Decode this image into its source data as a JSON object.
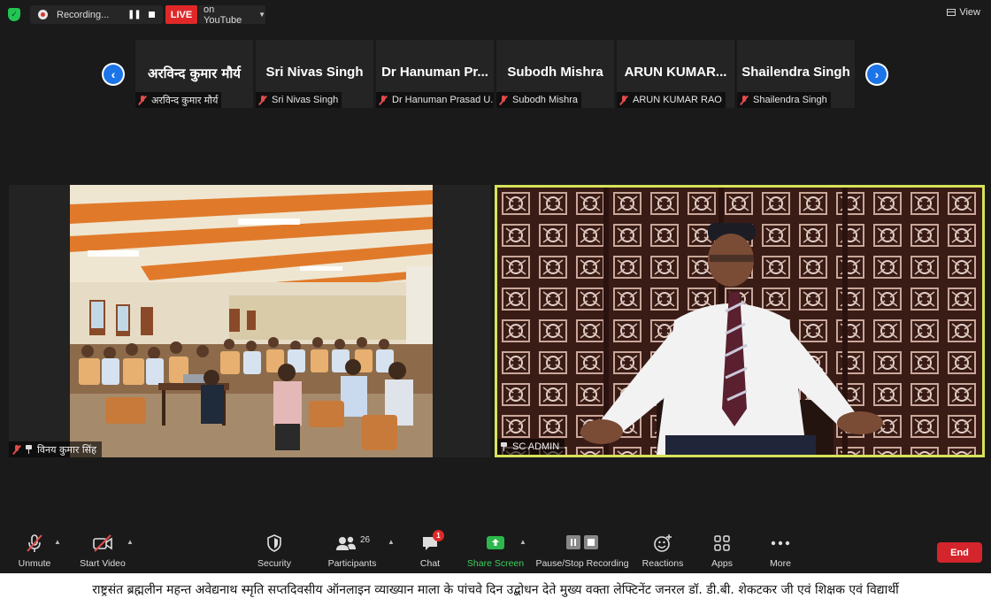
{
  "top_bar": {
    "recording_label": "Recording...",
    "live_label": "LIVE",
    "youtube_label": "on YouTube",
    "view_label": "View"
  },
  "thumbnails": [
    {
      "name": "अरविन्द कुमार मौर्य",
      "tag": "अरविन्द कुमार मौर्य"
    },
    {
      "name": "Sri Nivas Singh",
      "tag": "Sri Nivas Singh"
    },
    {
      "name": "Dr Hanuman Pr...",
      "tag": "Dr Hanuman Prasad U..."
    },
    {
      "name": "Subodh Mishra",
      "tag": "Subodh Mishra"
    },
    {
      "name": "ARUN  KUMAR...",
      "tag": "ARUN KUMAR RAO"
    },
    {
      "name": "Shailendra Singh",
      "tag": "Shailendra Singh"
    }
  ],
  "tiles": {
    "left_name": "विनय कुमार सिंह",
    "right_name": "SC ADMIN",
    "active_speaker_color": "#d7e35a"
  },
  "toolbar": {
    "unmute": "Unmute",
    "start_video": "Start Video",
    "security": "Security",
    "participants": "Participants",
    "participants_count": "26",
    "chat": "Chat",
    "chat_badge": "1",
    "share_screen": "Share Screen",
    "pause_recording": "Pause/Stop Recording",
    "reactions": "Reactions",
    "apps": "Apps",
    "more": "More",
    "end": "End"
  },
  "caption": "राष्ट्रसंत ब्रह्मलीन महन्त अवेद्यनाथ स्मृति सप्तदिवसीय ऑनलाइन व्याख्यान माला के पांचवे दिन उद्बोधन देते मुख्य वक्ता लेफ्टिनेंट जनरल डॉ. डी.बी. शेकटकर जी एवं शिक्षक एवं विद्यार्थी"
}
